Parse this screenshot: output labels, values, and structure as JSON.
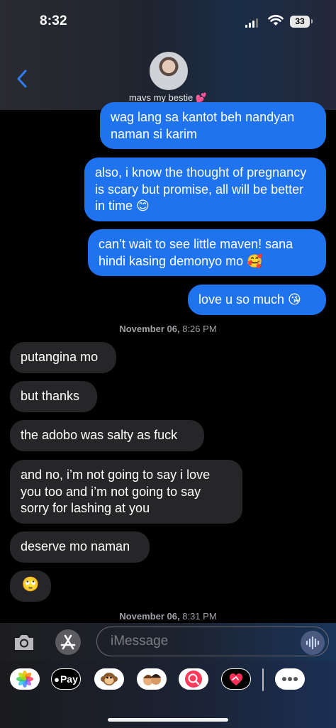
{
  "status_bar": {
    "time": "8:32",
    "battery": "33"
  },
  "contact": {
    "name": "mavs my bestie 💕"
  },
  "messages": {
    "sent": [
      "wag lang sa kantot beh nandyan naman si karim",
      "also, i know the thought of pregnancy is scary but promise, all will be better in time 😊",
      "can’t wait to see little maven! sana hindi kasing demonyo mo 🥰",
      "love u so much 😘"
    ],
    "timestamp_1": {
      "date": "November 06,",
      "time": "8:26 PM"
    },
    "received": [
      "putangina mo",
      "but thanks",
      "the adobo was salty as fuck",
      "and no, i’m not going to say i love you too and i’m not going to say sorry for lashing at you",
      "deserve mo naman",
      "🙄"
    ],
    "timestamp_2": {
      "date": "November 06,",
      "time": "8:31 PM"
    }
  },
  "input": {
    "placeholder": "iMessage"
  },
  "apps": {
    "apple_pay_label": "Pay",
    "items": [
      "photos-app",
      "apple-pay-app",
      "memoji-stickers-app",
      "memoji-app",
      "search-images-app",
      "digital-touch-app",
      "more-apps"
    ]
  },
  "colors": {
    "sent_bubble": "#1f73ee",
    "received_bubble": "#262628",
    "accent": "#2f7cf6"
  }
}
